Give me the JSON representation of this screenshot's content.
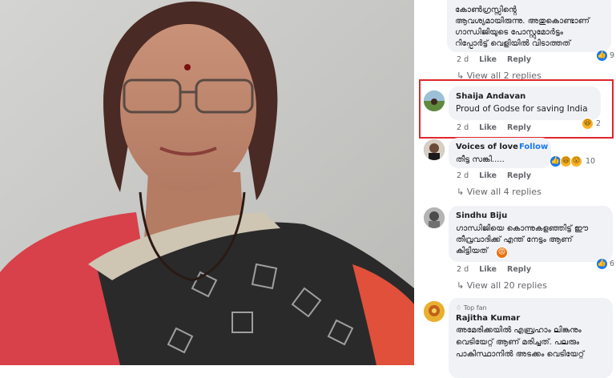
{
  "comments": [
    {
      "id": "c0",
      "text_lines": [
        "കോൺഗ്രസ്സിൻ്റെ",
        "ആവശ്യമായിരുന്നു. അതുകൊണ്ടാണ്",
        "ഗാന്ധിജിയുടെ പോസ്റ്റുമോർട്ടം",
        "റിപ്പോർട്ട് വെളിയിൽ വിടാത്തത്"
      ],
      "time": "2 d",
      "like_label": "Like",
      "reply_label": "Reply",
      "reactions": [
        "like"
      ],
      "reaction_count": "9",
      "view_replies": "View all 2 replies"
    },
    {
      "id": "c1",
      "name": "Shaija Andavan",
      "text_lines": [
        "Proud of Godse for saving India"
      ],
      "time": "2 d",
      "like_label": "Like",
      "reply_label": "Reply",
      "reactions": [
        "haha"
      ],
      "reaction_count": "2"
    },
    {
      "id": "c2",
      "name": "Voices of love",
      "follow_label": "Follow",
      "text_lines": [
        "തീട്ട സങ്കി....."
      ],
      "time": "2 d",
      "like_label": "Like",
      "reply_label": "Reply",
      "reactions": [
        "like",
        "haha",
        "wow"
      ],
      "reaction_count": "10",
      "view_replies": "View all 4 replies"
    },
    {
      "id": "c3",
      "name": "Sindhu Biju",
      "text_lines": [
        "ഗാന്ധിജിയെ കൊന്നുകളഞ്ഞിട്ട് ഈ",
        "തീവ്രവാദിക്ക് എന്ത് നേട്ടം ആണ്",
        "കിട്ടിയത്"
      ],
      "time": "2 d",
      "like_label": "Like",
      "reply_label": "Reply",
      "reactions": [
        "like"
      ],
      "reaction_count": "6",
      "view_replies": "View all 20 replies"
    },
    {
      "id": "c4",
      "badge": "Top fan",
      "name": "Rajitha Kumar",
      "text_lines": [
        "അമേരിക്കയിൽ എബ്രഹാം ലിങ്കനും",
        "വെടിയേറ്റ് ആണ് മരിച്ചത്. പലരും",
        "പാകിസ്ഥാനിൽ അടക്കം വെടിയേറ്റ്"
      ]
    }
  ]
}
